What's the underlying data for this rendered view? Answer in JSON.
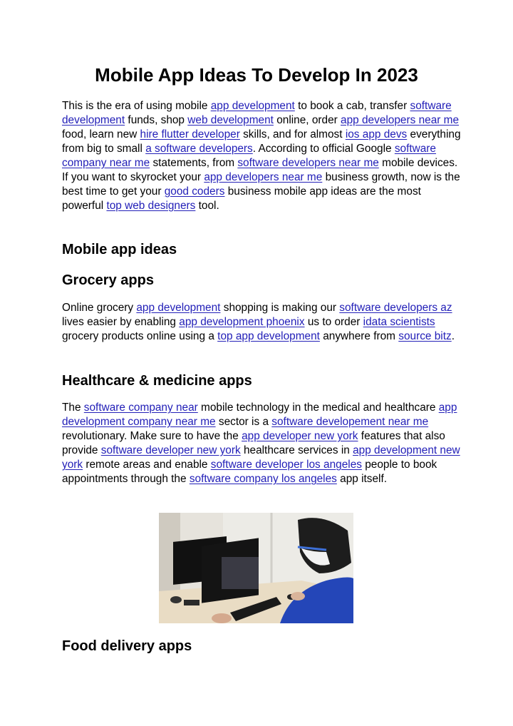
{
  "title": "Mobile App Ideas To Develop In 2023",
  "intro": [
    {
      "t": "This is the era of using mobile "
    },
    {
      "l": "app development"
    },
    {
      "t": " to book a cab, transfer "
    },
    {
      "l": "software development"
    },
    {
      "t": " funds, shop "
    },
    {
      "l": "web development"
    },
    {
      "t": " online, order "
    },
    {
      "l": "app developers near me"
    },
    {
      "t": " food, learn new "
    },
    {
      "l": "hire flutter developer"
    },
    {
      "t": " skills, and for almost "
    },
    {
      "l": "ios app devs"
    },
    {
      "t": " everything from big to small "
    },
    {
      "l": "a software developers"
    },
    {
      "t": ". According to official Google "
    },
    {
      "l": "software company near me"
    },
    {
      "t": " statements, from "
    },
    {
      "l": "software developers near me"
    },
    {
      "t": " mobile devices. If you want to skyrocket your "
    },
    {
      "l": "app developers near me"
    },
    {
      "t": " business growth, now is the best time to get your "
    },
    {
      "l": "good coders"
    },
    {
      "t": " business mobile app ideas are the most powerful "
    },
    {
      "l": "top web designers"
    },
    {
      "t": " tool."
    }
  ],
  "headings": {
    "mobile_app_ideas": "Mobile app ideas",
    "grocery": "Grocery apps",
    "healthcare": "Healthcare & medicine apps",
    "food": "Food delivery apps"
  },
  "grocery_para": [
    {
      "t": "Online grocery "
    },
    {
      "l": "app development"
    },
    {
      "t": " shopping is making our "
    },
    {
      "l": "software developers az"
    },
    {
      "t": " lives easier by enabling "
    },
    {
      "l": "app development phoenix"
    },
    {
      "t": " us to order "
    },
    {
      "l": "idata scientists"
    },
    {
      "t": " grocery products online using a "
    },
    {
      "l": "top app development"
    },
    {
      "t": " anywhere from "
    },
    {
      "l": "source bitz"
    },
    {
      "t": "."
    }
  ],
  "healthcare_para": [
    {
      "t": "The "
    },
    {
      "l": "software company near"
    },
    {
      "t": " mobile technology in the medical and healthcare "
    },
    {
      "l": "app development company near me"
    },
    {
      "t": " sector is a "
    },
    {
      "l": "software developement near me"
    },
    {
      "t": " revolutionary. Make sure to have the "
    },
    {
      "l": "app developer new york"
    },
    {
      "t": " features that also provide "
    },
    {
      "l": "software developer new york"
    },
    {
      "t": " healthcare services in "
    },
    {
      "l": "app development new york"
    },
    {
      "t": " remote areas and enable "
    },
    {
      "l": "software developer los angeles"
    },
    {
      "t": " people to book appointments through the "
    },
    {
      "l": "software company los angeles"
    },
    {
      "t": " app itself."
    }
  ],
  "photo": {
    "alt": "Man wearing face mask and glasses using a computer with video call"
  },
  "colors": {
    "link": "#2320b8",
    "text": "#000000",
    "background": "#ffffff"
  }
}
